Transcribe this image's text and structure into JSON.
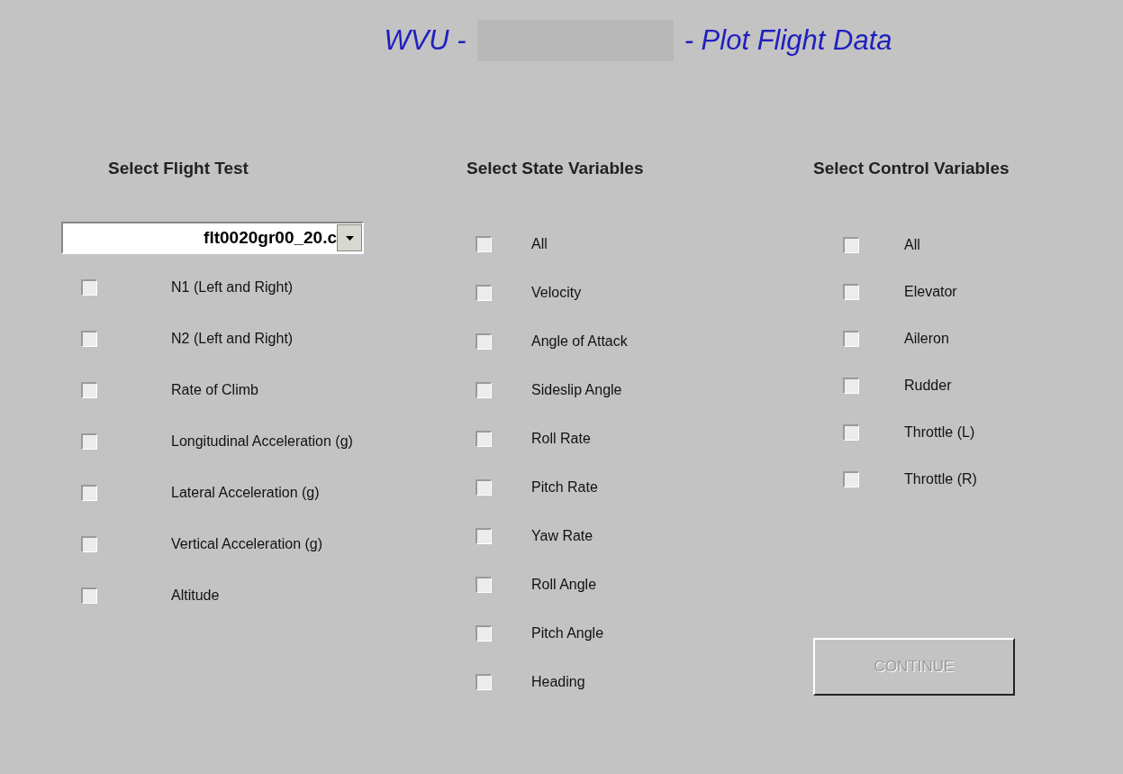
{
  "title": {
    "prefix": "WVU -",
    "suffix": "- Plot Flight Data"
  },
  "flight_test": {
    "heading": "Select Flight Test",
    "dropdown_value": "flt0020gr00_20.c",
    "options": [
      {
        "label": "N1 (Left and Right)",
        "checked": false
      },
      {
        "label": "N2 (Left and Right)",
        "checked": false
      },
      {
        "label": "Rate of Climb",
        "checked": false
      },
      {
        "label": "Longitudinal Acceleration (g)",
        "checked": false
      },
      {
        "label": "Lateral Acceleration (g)",
        "checked": false
      },
      {
        "label": "Vertical Acceleration (g)",
        "checked": false
      },
      {
        "label": "Altitude",
        "checked": false
      }
    ]
  },
  "state_variables": {
    "heading": "Select State Variables",
    "options": [
      {
        "label": "All",
        "checked": false
      },
      {
        "label": "Velocity",
        "checked": false
      },
      {
        "label": "Angle of Attack",
        "checked": false
      },
      {
        "label": "Sideslip Angle",
        "checked": false
      },
      {
        "label": "Roll Rate",
        "checked": false
      },
      {
        "label": "Pitch Rate",
        "checked": false
      },
      {
        "label": "Yaw Rate",
        "checked": false
      },
      {
        "label": "Roll Angle",
        "checked": false
      },
      {
        "label": "Pitch Angle",
        "checked": false
      },
      {
        "label": "Heading",
        "checked": false
      }
    ]
  },
  "control_variables": {
    "heading": "Select Control Variables",
    "options": [
      {
        "label": "All",
        "checked": false
      },
      {
        "label": "Elevator",
        "checked": false
      },
      {
        "label": "Aileron",
        "checked": false
      },
      {
        "label": "Rudder",
        "checked": false
      },
      {
        "label": "Throttle (L)",
        "checked": false
      },
      {
        "label": "Throttle (R)",
        "checked": false
      }
    ]
  },
  "continue_button": {
    "label": "CONTINUE",
    "disabled": true
  }
}
